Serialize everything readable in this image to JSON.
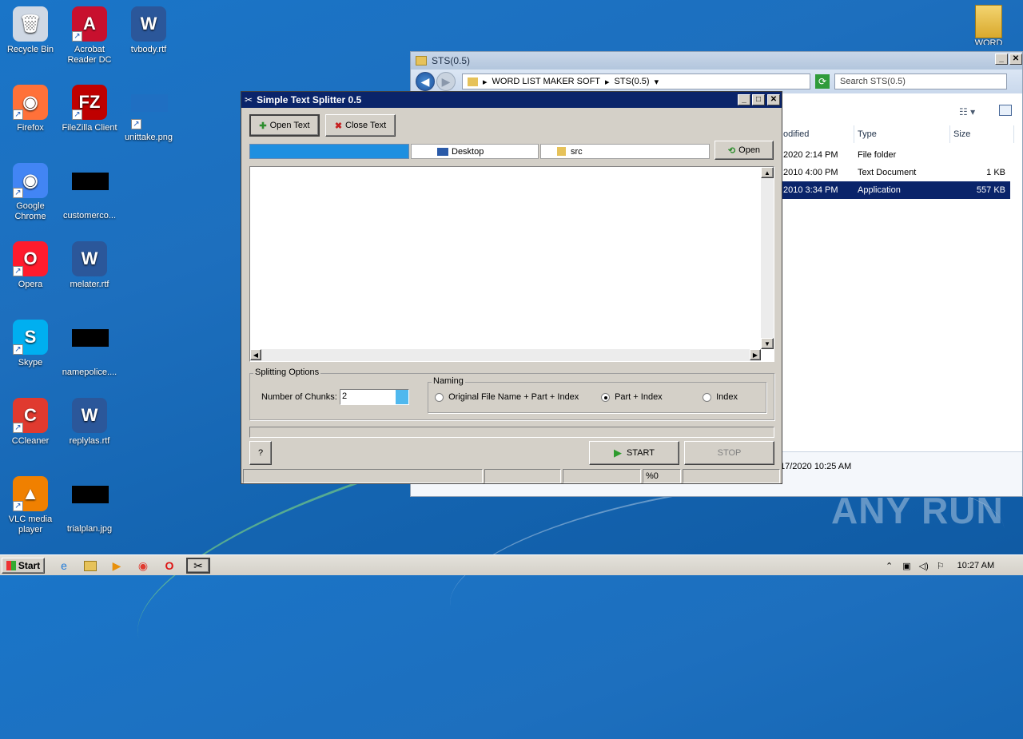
{
  "desktop": {
    "icons": [
      {
        "label": "Recycle Bin",
        "glyph": "🗑",
        "color": "#cfd8e4"
      },
      {
        "label": "Acrobat Reader DC",
        "glyph": "A",
        "color": "#c8102e"
      },
      {
        "label": "tvbody.rtf",
        "glyph": "W",
        "color": "#2b579a"
      },
      {
        "label": "Firefox",
        "glyph": "◉",
        "color": "#ff7139"
      },
      {
        "label": "FileZilla Client",
        "glyph": "FZ",
        "color": "#bf0000"
      },
      {
        "label": "unittake.png",
        "glyph": "",
        "color": "#1f6fc2"
      },
      {
        "label": "Google Chrome",
        "glyph": "◉",
        "color": "#4285f4"
      },
      {
        "label": "customerco...",
        "glyph": "",
        "color": "#000000"
      },
      {
        "label": "Opera",
        "glyph": "O",
        "color": "#ff1b2d"
      },
      {
        "label": "melater.rtf",
        "glyph": "W",
        "color": "#2b579a"
      },
      {
        "label": "Skype",
        "glyph": "S",
        "color": "#00aff0"
      },
      {
        "label": "namepolice....",
        "glyph": "",
        "color": "#000000"
      },
      {
        "label": "CCleaner",
        "glyph": "C",
        "color": "#e03a2f"
      },
      {
        "label": "replylas.rtf",
        "glyph": "W",
        "color": "#2b579a"
      },
      {
        "label": "VLC media player",
        "glyph": "▲",
        "color": "#f08000"
      },
      {
        "label": "trialplan.jpg",
        "glyph": "",
        "color": "#000000"
      }
    ],
    "top_right_label": "WORD LIST"
  },
  "explorer": {
    "title": "STS(0.5)",
    "breadcrumb": [
      "WORD LIST MAKER SOFT",
      "STS(0.5)"
    ],
    "search_placeholder": "Search STS(0.5)",
    "columns": {
      "modified": "odified",
      "type": "Type",
      "size": "Size"
    },
    "rows": [
      {
        "date": "2020 2:14 PM",
        "type": "File folder",
        "size": "",
        "selected": false
      },
      {
        "date": "2010 4:00 PM",
        "type": "Text Document",
        "size": "1 KB",
        "selected": false
      },
      {
        "date": "2010 3:34 PM",
        "type": "Application",
        "size": "557 KB",
        "selected": true
      }
    ],
    "details_text": "17/2020 10:25 AM"
  },
  "sts": {
    "title": "Simple Text Splitter 0.5",
    "open_text_label": "Open Text",
    "close_text_label": "Close Text",
    "tab_desktop": "Desktop",
    "tab_src": "src",
    "open_label": "Open",
    "splitting_options_label": "Splitting Options",
    "chunks_label": "Number of Chunks:",
    "chunks_value": "2",
    "naming_label": "Naming",
    "naming_options": [
      {
        "label": "Original File Name + Part + Index",
        "selected": false
      },
      {
        "label": "Part + Index",
        "selected": true
      },
      {
        "label": "Index",
        "selected": false
      }
    ],
    "help_label": "?",
    "start_label": "START",
    "stop_label": "STOP",
    "status_percent": "%0"
  },
  "taskbar": {
    "start_label": "Start",
    "clock": "10:27 AM"
  },
  "watermark": "ANY RUN",
  "colors": {
    "titlebar_active": "#0a246a",
    "progress_blue": "#1e8fe0",
    "selection": "#0a246a"
  }
}
